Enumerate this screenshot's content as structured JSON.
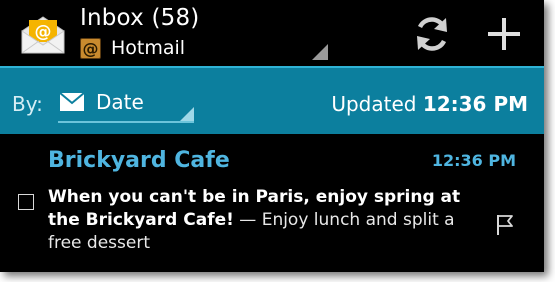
{
  "header": {
    "title": "Inbox (58)",
    "account_name": "Hotmail",
    "account_icon_glyph": "@",
    "app_icon": "email-app-icon",
    "refresh_icon": "refresh-icon",
    "compose_icon": "plus-icon"
  },
  "filter": {
    "by_label": "By:",
    "sort_icon": "envelope-icon",
    "sort_value": "Date",
    "updated_label": "Updated",
    "updated_time": "12:36 PM"
  },
  "messages": [
    {
      "sender": "Brickyard Cafe",
      "time": "12:36 PM",
      "subject": "When you can't be in Paris, enjoy spring at the Brickyard Cafe!",
      "preview": " — Enjoy lunch and split a free dessert",
      "checked": false,
      "flag_icon": "flag-icon"
    }
  ],
  "colors": {
    "accent_bar": "#0c7f9e",
    "accent_text": "#4fb5e0",
    "background": "#000000"
  }
}
